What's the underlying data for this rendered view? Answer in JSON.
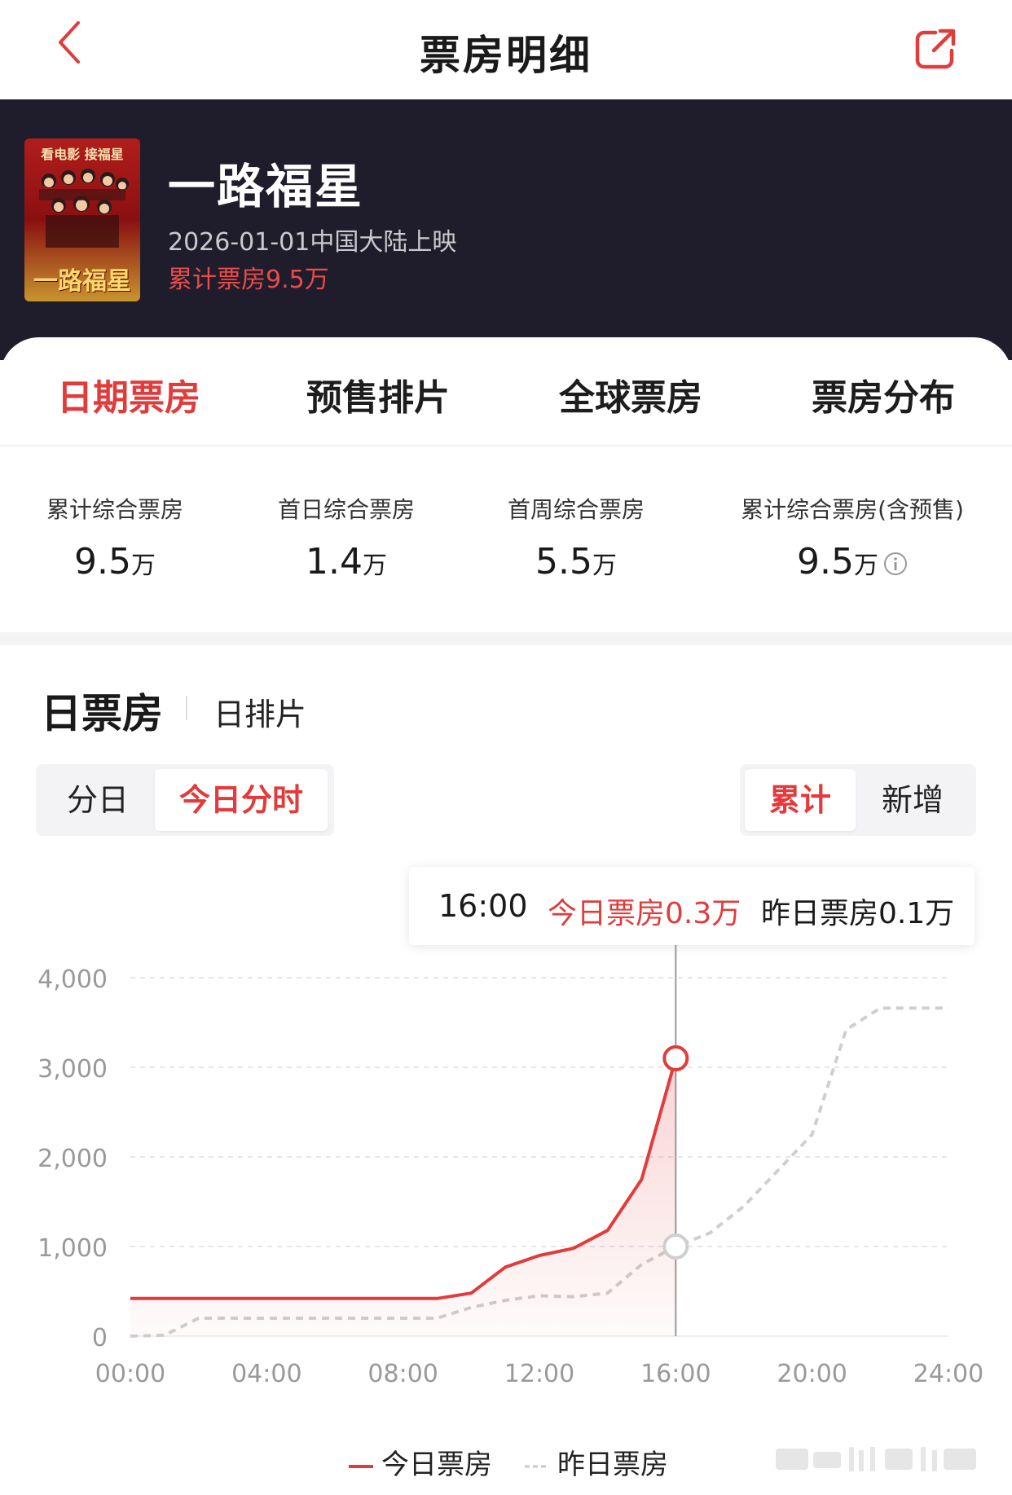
{
  "nav": {
    "title": "票房明细"
  },
  "movie": {
    "title": "一路福星",
    "release": "2026-01-01中国大陆上映",
    "total_box_office": "累计票房9.5万",
    "poster_top_text": "看电影 接福星",
    "poster_title": "一路福星"
  },
  "tabs": [
    {
      "label": "日期票房",
      "active": true
    },
    {
      "label": "预售排片",
      "active": false
    },
    {
      "label": "全球票房",
      "active": false
    },
    {
      "label": "票房分布",
      "active": false
    }
  ],
  "stats": [
    {
      "label": "累计综合票房",
      "value": "9.5",
      "unit": "万"
    },
    {
      "label": "首日综合票房",
      "value": "1.4",
      "unit": "万"
    },
    {
      "label": "首周综合票房",
      "value": "5.5",
      "unit": "万"
    },
    {
      "label": "累计综合票房(含预售)",
      "value": "9.5",
      "unit": "万"
    }
  ],
  "section": {
    "title": "日票房",
    "subtitle": "日排片"
  },
  "segment_left": [
    {
      "label": "分日",
      "active": false
    },
    {
      "label": "今日分时",
      "active": true
    }
  ],
  "segment_right": [
    {
      "label": "累计",
      "active": true
    },
    {
      "label": "新增",
      "active": false
    }
  ],
  "tooltip": {
    "time": "16:00",
    "today": "今日票房0.3万",
    "yesterday": "昨日票房0.1万"
  },
  "colors": {
    "accent": "#e23b3b",
    "hero_bg": "#1f1d2b",
    "yesterday_line": "#cfcfcf"
  },
  "legend": [
    {
      "label": "今日票房",
      "style": "solid"
    },
    {
      "label": "昨日票房",
      "style": "dashed"
    }
  ],
  "chart_data": {
    "type": "line",
    "y_ticks": [
      "4,000",
      "3,000",
      "2,000",
      "1,000",
      "0"
    ],
    "x_ticks": [
      "00:00",
      "04:00",
      "08:00",
      "12:00",
      "16:00",
      "20:00",
      "24:00"
    ],
    "ylim": [
      0,
      4000
    ],
    "xlim": [
      0,
      24
    ],
    "grid": true,
    "legend_position": "bottom",
    "highlight_x": 16,
    "series": [
      {
        "name": "今日票房",
        "color": "#e23b3b",
        "style": "solid",
        "area": true,
        "points": [
          [
            0,
            420
          ],
          [
            9,
            420
          ],
          [
            10,
            480
          ],
          [
            11,
            770
          ],
          [
            12,
            900
          ],
          [
            13,
            980
          ],
          [
            14,
            1180
          ],
          [
            15,
            1750
          ],
          [
            16,
            3100
          ]
        ]
      },
      {
        "name": "昨日票房",
        "color": "#cfcfcf",
        "style": "dashed",
        "area": false,
        "points": [
          [
            0,
            0
          ],
          [
            1,
            10
          ],
          [
            2,
            200
          ],
          [
            3,
            200
          ],
          [
            6,
            200
          ],
          [
            9,
            200
          ],
          [
            10,
            320
          ],
          [
            11,
            400
          ],
          [
            12,
            450
          ],
          [
            13,
            440
          ],
          [
            14,
            480
          ],
          [
            15,
            800
          ],
          [
            16,
            1000
          ],
          [
            17,
            1150
          ],
          [
            18,
            1450
          ],
          [
            19,
            1850
          ],
          [
            20,
            2250
          ],
          [
            21,
            3420
          ],
          [
            22,
            3660
          ],
          [
            24,
            3660
          ]
        ]
      }
    ]
  }
}
